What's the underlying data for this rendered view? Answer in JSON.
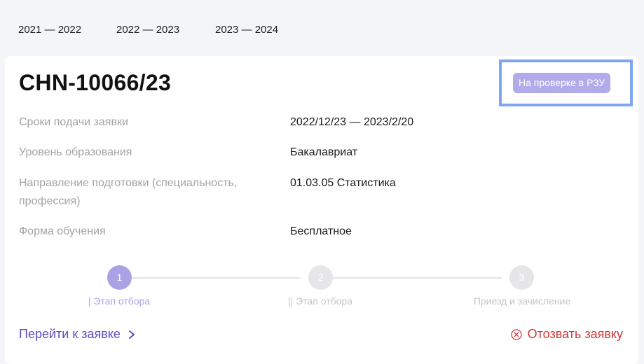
{
  "year_tabs": [
    "2021 — 2022",
    "2022 — 2023",
    "2023 — 2024"
  ],
  "application": {
    "id": "CHN-10066/23",
    "status": "На проверке в РЗУ",
    "colors": {
      "status_bg": "#b0acea",
      "accent": "#5b4cc4",
      "danger": "#d43636"
    }
  },
  "fields": [
    {
      "label": "Сроки подачи заявки",
      "value": "2022/12/23 — 2023/2/20"
    },
    {
      "label": "Уровень образования",
      "value": "Бакалавриат"
    },
    {
      "label": "Направление подготовки (специальность, профессия)",
      "value": "01.03.05 Статистика"
    },
    {
      "label": "Форма обучения",
      "value": "Бесплатное"
    }
  ],
  "steps": [
    {
      "number": "1",
      "label": "| Этап отбора",
      "active": true
    },
    {
      "number": "2",
      "label": "|| Этап отбора",
      "active": false
    },
    {
      "number": "3",
      "label": "Приезд и зачисление",
      "active": false
    }
  ],
  "actions": {
    "goto_label": "Перейти к заявке",
    "goto_icon": "chevron-right-icon",
    "withdraw_label": "Отозвать заявку",
    "withdraw_icon": "x-circle-icon"
  }
}
